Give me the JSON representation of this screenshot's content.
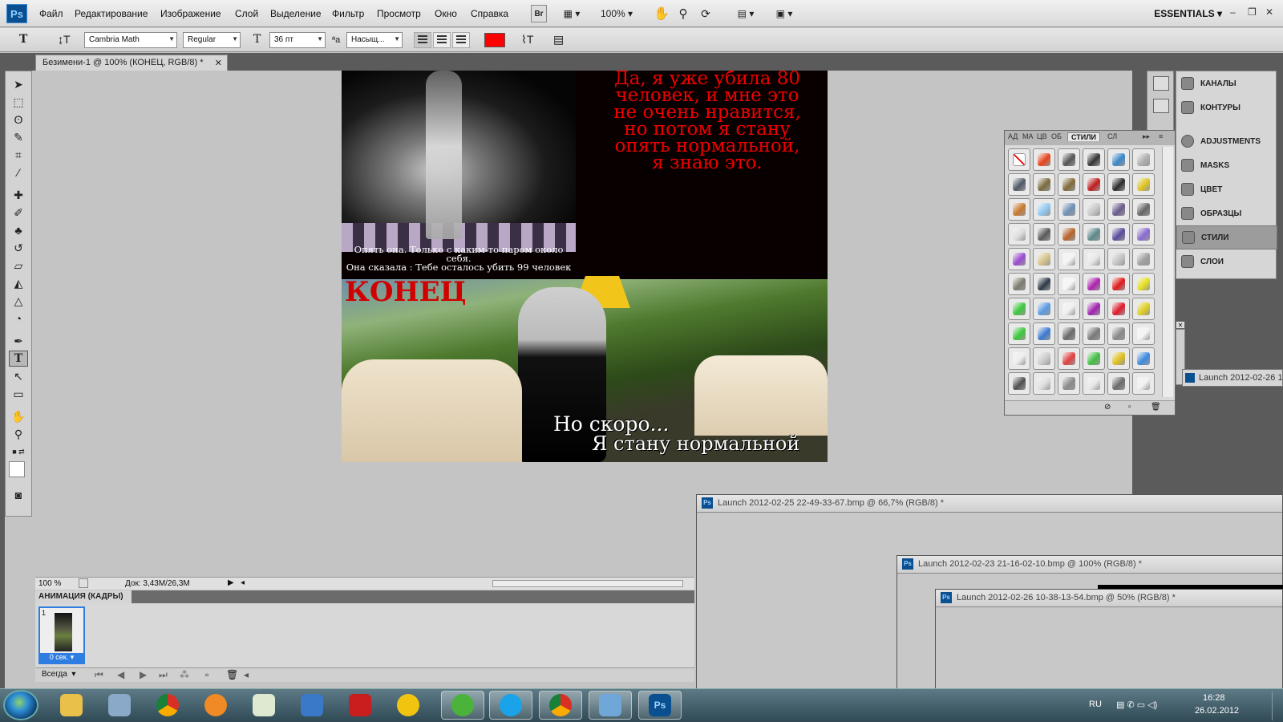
{
  "app": {
    "logo": "Ps",
    "workspace": "ESSENTIALS",
    "zoom_menu": "100%",
    "bridge": "Br"
  },
  "menu": [
    "Файл",
    "Редактирование",
    "Изображение",
    "Слой",
    "Выделение",
    "Фильтр",
    "Просмотр",
    "Окно",
    "Справка"
  ],
  "options": {
    "font_family": "Cambria Math",
    "font_style": "Regular",
    "font_size": "36 пт",
    "antialias": "Насыщ...",
    "text_color": "#ff0000"
  },
  "document": {
    "tab_title": "Безимени-1 @ 100% (КОНЕЦ, RGB/8) *",
    "red_text": [
      "Да, я уже убила 80",
      "человек, и мне это",
      "не очень нравится,",
      "но потом я стану",
      "опять нормальной,",
      "я знаю это."
    ],
    "caption": [
      "Опять она. Только с каким-то паром около",
      "себя.",
      "Она сказала : Тебе осталось убить 99 человек"
    ],
    "title_overlay": "КОНЕЦ",
    "bottom_text_1": "Но скоро...",
    "bottom_text_2": "Я стану нормальной"
  },
  "status": {
    "zoom": "100 %",
    "doc_info": "Док: 3,43M/26,3M"
  },
  "animation": {
    "panel_title": "АНИМАЦИЯ (КАДРЫ)",
    "frame_number": "1",
    "frame_delay": "0 сек.",
    "loop": "Всегда"
  },
  "dock": {
    "items": [
      "КАНАЛЫ",
      "КОНТУРЫ",
      "ADJUSTMENTS",
      "MASKS",
      "ЦВЕТ",
      "ОБРАЗЦЫ",
      "СТИЛИ",
      "СЛОИ"
    ],
    "selected": "СТИЛИ"
  },
  "styles_panel": {
    "tabs": [
      "АД",
      "МА",
      "ЦВ",
      "ОБ",
      "СТИЛИ",
      "СЛ"
    ],
    "selected_tab": "СТИЛИ",
    "swatches": [
      "none",
      "#e8431a",
      "#555555",
      "#333333",
      "#3a86c8",
      "#b0b0b0",
      "#505a66",
      "#7a6a3c",
      "#806838",
      "#c01c1c",
      "#2b2b2b",
      "#e0c520",
      "#c9782c",
      "#8fc8f0",
      "#6f8fb4",
      "#c8c8c8",
      "#6a5a8a",
      "#666666",
      "#dcdcdc",
      "#5a5a5a",
      "#b6632c",
      "#5d8a8a",
      "#5a4a9a",
      "#8a6ad0",
      "#9a4ad0",
      "#d6c48a",
      "#f4f4f4",
      "#e6e6e6",
      "#c4c4c4",
      "#a0a0a0",
      "#7c7c6c",
      "#2d3a48",
      "#f6f6f6",
      "#b020b0",
      "#e01a1a",
      "#e6e020",
      "#3cc83c",
      "#5a9ae0",
      "#f0f0f0",
      "#a020b0",
      "#e01a2a",
      "#e0d020",
      "#3cc83c",
      "#3a7ad0",
      "#6a6a6a",
      "#7a7a7a",
      "#8a8a8a",
      "#f4f4f4",
      "#eeeeee",
      "#cccccc",
      "#e04040",
      "#40c040",
      "#e0c020",
      "#3a8ae0",
      "#505050",
      "#dddddd",
      "#8a8a8a",
      "#e8e8e8",
      "#6a6a6a",
      "#f0f0f0"
    ]
  },
  "floating_windows": [
    "Launch 2012-02-25 22-49-33-67.bmp @ 66,7% (RGB/8) *",
    "Launch 2012-02-23 21-16-02-10.bmp @ 100% (RGB/8) *",
    "Launch 2012-02-26 10-38-13-54.bmp @ 50% (RGB/8) *"
  ],
  "minimized_window": "Launch 2012-02-26 1",
  "tray": {
    "lang": "RU",
    "time": "16:28",
    "date": "26.02.2012"
  }
}
